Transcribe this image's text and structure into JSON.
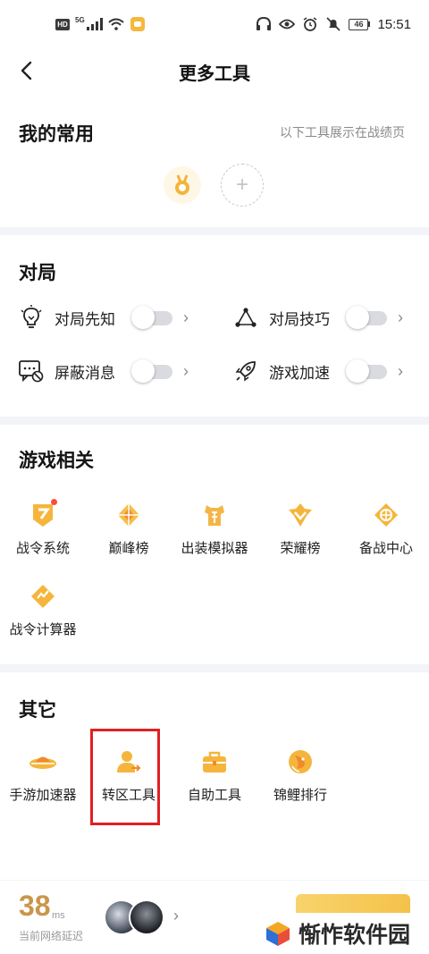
{
  "status_bar": {
    "network_badge": "HD",
    "signal_label": "5G",
    "battery_level": "46",
    "time": "15:51"
  },
  "nav": {
    "title": "更多工具"
  },
  "favorites": {
    "title": "我的常用",
    "note": "以下工具展示在战绩页",
    "add_symbol": "+"
  },
  "match": {
    "title": "对局",
    "toggles": [
      {
        "label": "对局先知",
        "icon": "lightbulb-icon",
        "enabled": false
      },
      {
        "label": "对局技巧",
        "icon": "triangle-nodes-icon",
        "enabled": false
      },
      {
        "label": "屏蔽消息",
        "icon": "message-block-icon",
        "enabled": false
      },
      {
        "label": "游戏加速",
        "icon": "rocket-icon",
        "enabled": false
      }
    ]
  },
  "game_related": {
    "title": "游戏相关",
    "items": [
      {
        "label": "战令系统",
        "icon": "battle-pass-icon",
        "badge": true
      },
      {
        "label": "巅峰榜",
        "icon": "peak-rank-icon"
      },
      {
        "label": "出装模拟器",
        "icon": "armor-sim-icon"
      },
      {
        "label": "荣耀榜",
        "icon": "glory-rank-icon"
      },
      {
        "label": "备战中心",
        "icon": "prep-center-icon"
      },
      {
        "label": "战令计算器",
        "icon": "calculator-icon"
      }
    ]
  },
  "others": {
    "title": "其它",
    "items": [
      {
        "label": "手游加速器",
        "icon": "accelerator-icon"
      },
      {
        "label": "转区工具",
        "icon": "transfer-user-icon"
      },
      {
        "label": "自助工具",
        "icon": "toolbox-icon"
      },
      {
        "label": "锦鲤排行",
        "icon": "koi-icon"
      }
    ]
  },
  "bottom": {
    "ping_value": "38",
    "ping_unit": "ms",
    "ping_caption": "当前网络延迟"
  },
  "watermark": {
    "text": "惭怍软件园"
  },
  "colors": {
    "accent": "#f5b83a",
    "highlight": "#e02020",
    "ping": "#c9964b"
  }
}
